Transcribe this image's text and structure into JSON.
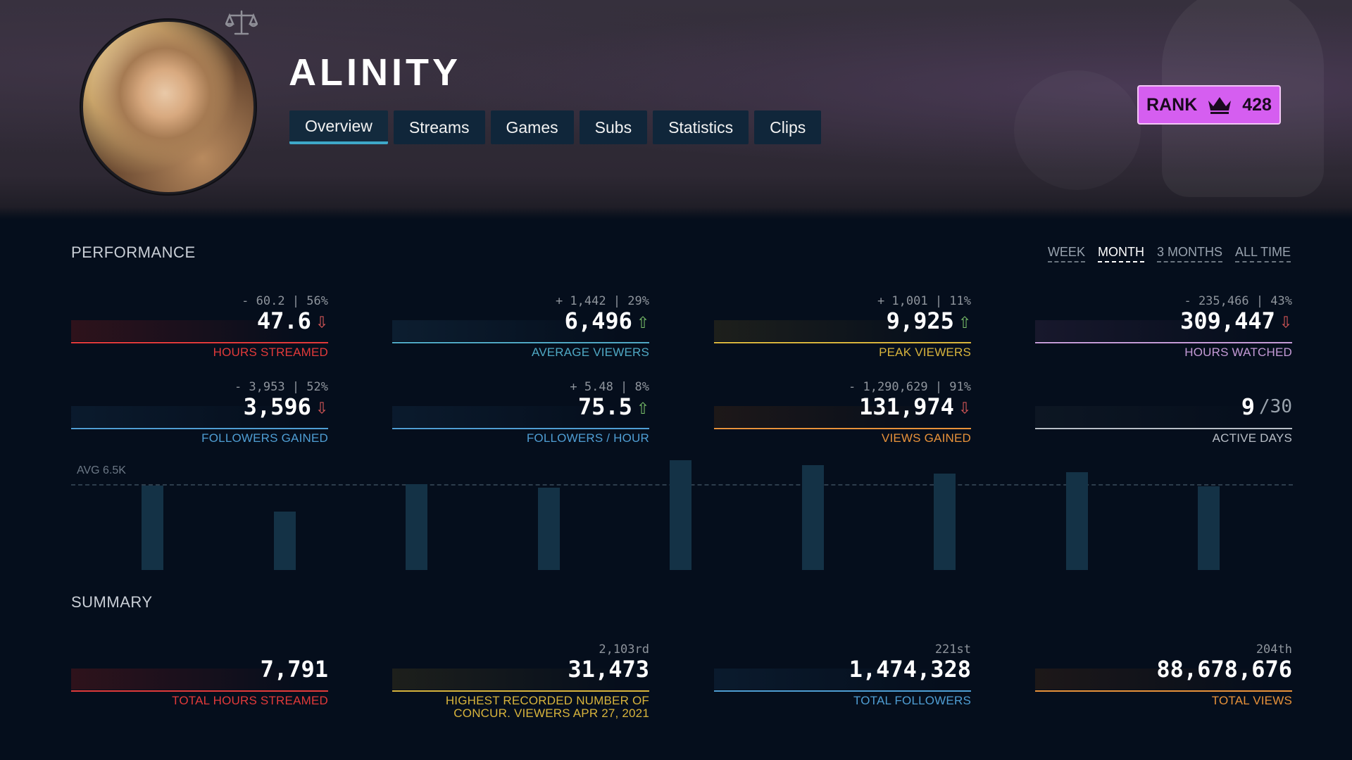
{
  "profile": {
    "name": "ALINITY",
    "avatar_alt": "avatar"
  },
  "tabs": [
    "Overview",
    "Streams",
    "Games",
    "Subs",
    "Statistics",
    "Clips"
  ],
  "active_tab": "Overview",
  "rank": {
    "label": "RANK",
    "value": "428"
  },
  "performance": {
    "title": "PERFORMANCE",
    "periods": [
      "WEEK",
      "MONTH",
      "3 MONTHS",
      "ALL TIME"
    ],
    "active_period": "MONTH",
    "stats": [
      {
        "delta": "- 60.2 | 56%",
        "value": "47.6",
        "arrow": "down",
        "label": "HOURS STREAMED",
        "color": "#e23a3a"
      },
      {
        "delta": "+ 1,442 | 29%",
        "value": "6,496",
        "arrow": "up",
        "label": "AVERAGE VIEWERS",
        "color": "#4fa8c4"
      },
      {
        "delta": "+ 1,001 | 11%",
        "value": "9,925",
        "arrow": "up",
        "label": "PEAK VIEWERS",
        "color": "#d8b43c"
      },
      {
        "delta": "- 235,466 | 43%",
        "value": "309,447",
        "arrow": "down",
        "label": "HOURS WATCHED",
        "color": "#c49ad6"
      },
      {
        "delta": "- 3,953 | 52%",
        "value": "3,596",
        "arrow": "down",
        "label": "FOLLOWERS GAINED",
        "color": "#4f9ed4"
      },
      {
        "delta": "+ 5.48 | 8%",
        "value": "75.5",
        "arrow": "up",
        "label": "FOLLOWERS / HOUR",
        "color": "#4f9ed4"
      },
      {
        "delta": "- 1,290,629 | 91%",
        "value": "131,974",
        "arrow": "down",
        "label": "VIEWS GAINED",
        "color": "#e8923a"
      },
      {
        "delta": "",
        "value": "9",
        "denominator": "/30",
        "arrow": "",
        "label": "ACTIVE DAYS",
        "color": "#b8bec6"
      }
    ]
  },
  "chart": {
    "avg_label": "AVG 6.5K",
    "avg_value": 6500,
    "ymax": 8500,
    "bars": [
      6400,
      4400,
      6500,
      6200,
      8300,
      7900,
      7300,
      7400,
      6300
    ]
  },
  "summary": {
    "title": "SUMMARY",
    "stats": [
      {
        "rank": "",
        "value": "7,791",
        "label": "TOTAL HOURS STREAMED",
        "color": "#e23a3a"
      },
      {
        "rank": "2,103rd",
        "value": "31,473",
        "label": "HIGHEST RECORDED NUMBER OF\nCONCUR. VIEWERS APR 27, 2021",
        "color": "#d8b43c"
      },
      {
        "rank": "221st",
        "value": "1,474,328",
        "label": "TOTAL FOLLOWERS",
        "color": "#4f9ed4"
      },
      {
        "rank": "204th",
        "value": "88,678,676",
        "label": "TOTAL VIEWS",
        "color": "#e8923a"
      }
    ]
  },
  "icons": {
    "scale": "balance-scale-icon",
    "crown": "crown-icon"
  },
  "colors": {
    "rank_bg": "#d55ef0",
    "tab_bg": "#10263a",
    "accent": "#3ea8c8"
  }
}
